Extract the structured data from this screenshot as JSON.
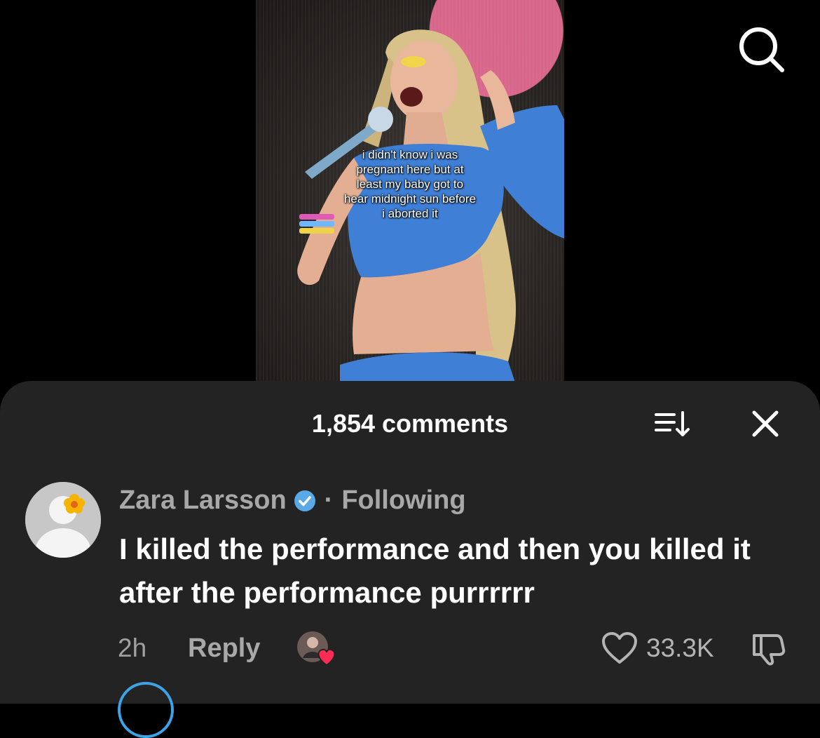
{
  "video": {
    "overlay_caption": "i didn't know i was\npregnant here but at\nleast my baby got to\nhear midnight sun before\ni aborted it",
    "search_icon": "search-icon"
  },
  "comments_sheet": {
    "title": "1,854 comments",
    "sort_icon": "sort-icon",
    "close_icon": "close-icon"
  },
  "comment": {
    "author": "Zara Larsson",
    "verified_icon": "verified-badge-icon",
    "separator": "·",
    "follow_status": "Following",
    "text": "I killed the performance and then you killed it after the performance purrrrrr",
    "time": "2h",
    "reply_label": "Reply",
    "like_count": "33.3K",
    "colors": {
      "verified": "#5aa9e6",
      "heart_badge": "#fe2c55",
      "sheet_bg": "#232323"
    }
  }
}
